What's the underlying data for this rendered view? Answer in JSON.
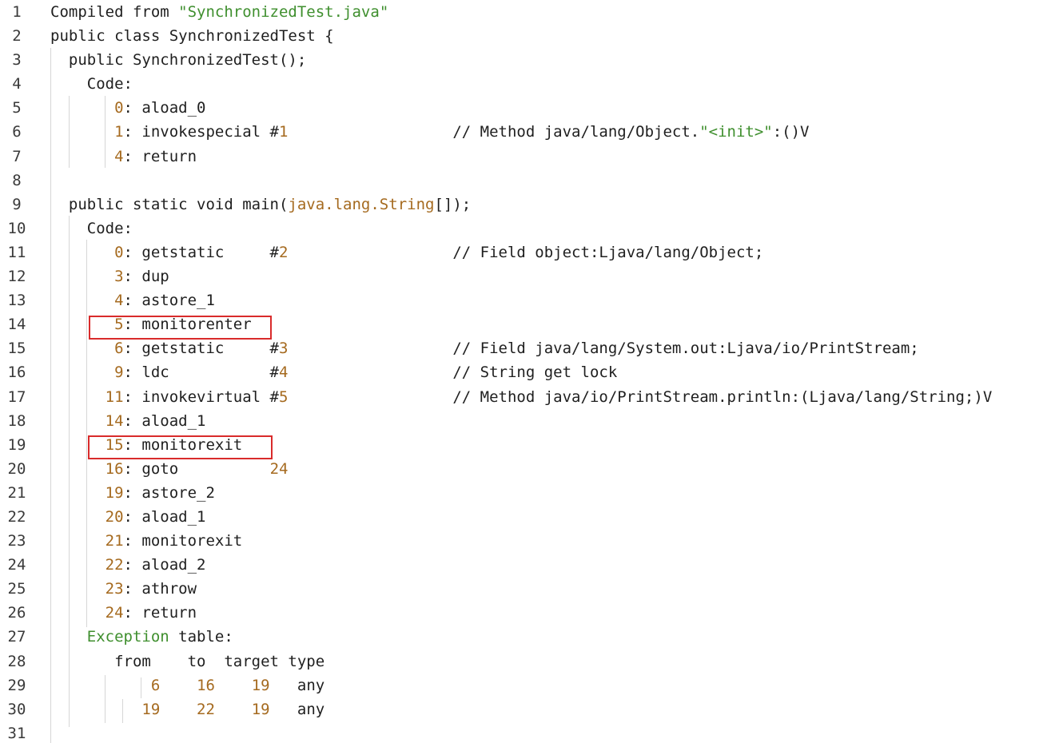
{
  "editor": {
    "lines": [
      {
        "n": "1",
        "segs": [
          [
            "Compiled from ",
            "t"
          ],
          [
            "\"SynchronizedTest.java\"",
            "s"
          ]
        ]
      },
      {
        "n": "2",
        "segs": [
          [
            "public class SynchronizedTest {",
            "t"
          ]
        ]
      },
      {
        "n": "3",
        "segs": [
          [
            "  public SynchronizedTest();",
            "t"
          ]
        ]
      },
      {
        "n": "4",
        "segs": [
          [
            "    Code:",
            "t"
          ]
        ]
      },
      {
        "n": "5",
        "segs": [
          [
            "       ",
            "t"
          ],
          [
            "0",
            "n"
          ],
          [
            ": aload_0",
            "t"
          ]
        ]
      },
      {
        "n": "6",
        "segs": [
          [
            "       ",
            "t"
          ],
          [
            "1",
            "n"
          ],
          [
            ": invokespecial #",
            "t"
          ],
          [
            "1",
            "n"
          ],
          [
            "                  // Method java/lang/Object.",
            "t"
          ],
          [
            "\"<init>\"",
            "s"
          ],
          [
            ":()V",
            "t"
          ]
        ]
      },
      {
        "n": "7",
        "segs": [
          [
            "       ",
            "t"
          ],
          [
            "4",
            "n"
          ],
          [
            ": return",
            "t"
          ]
        ]
      },
      {
        "n": "8",
        "segs": [
          [
            "",
            "t"
          ]
        ]
      },
      {
        "n": "9",
        "segs": [
          [
            "  public static void main(",
            "t"
          ],
          [
            "java.lang.String",
            "n"
          ],
          [
            "[]);",
            "t"
          ]
        ]
      },
      {
        "n": "10",
        "segs": [
          [
            "    Code:",
            "t"
          ]
        ]
      },
      {
        "n": "11",
        "segs": [
          [
            "       ",
            "t"
          ],
          [
            "0",
            "n"
          ],
          [
            ": getstatic     #",
            "t"
          ],
          [
            "2",
            "n"
          ],
          [
            "                  // Field object:Ljava/lang/Object;",
            "t"
          ]
        ]
      },
      {
        "n": "12",
        "segs": [
          [
            "       ",
            "t"
          ],
          [
            "3",
            "n"
          ],
          [
            ": dup",
            "t"
          ]
        ]
      },
      {
        "n": "13",
        "segs": [
          [
            "       ",
            "t"
          ],
          [
            "4",
            "n"
          ],
          [
            ": astore_1",
            "t"
          ]
        ]
      },
      {
        "n": "14",
        "segs": [
          [
            "       ",
            "t"
          ],
          [
            "5",
            "n"
          ],
          [
            ": monitorenter",
            "t"
          ]
        ]
      },
      {
        "n": "15",
        "segs": [
          [
            "       ",
            "t"
          ],
          [
            "6",
            "n"
          ],
          [
            ": getstatic     #",
            "t"
          ],
          [
            "3",
            "n"
          ],
          [
            "                  // Field java/lang/System.out:Ljava/io/PrintStream;",
            "t"
          ]
        ]
      },
      {
        "n": "16",
        "segs": [
          [
            "       ",
            "t"
          ],
          [
            "9",
            "n"
          ],
          [
            ": ldc           #",
            "t"
          ],
          [
            "4",
            "n"
          ],
          [
            "                  // String get lock",
            "t"
          ]
        ]
      },
      {
        "n": "17",
        "segs": [
          [
            "      ",
            "t"
          ],
          [
            "11",
            "n"
          ],
          [
            ": invokevirtual #",
            "t"
          ],
          [
            "5",
            "n"
          ],
          [
            "                  // Method java/io/PrintStream.println:(Ljava/lang/String;)V",
            "t"
          ]
        ]
      },
      {
        "n": "18",
        "segs": [
          [
            "      ",
            "t"
          ],
          [
            "14",
            "n"
          ],
          [
            ": aload_1",
            "t"
          ]
        ]
      },
      {
        "n": "19",
        "segs": [
          [
            "      ",
            "t"
          ],
          [
            "15",
            "n"
          ],
          [
            ": monitorexit",
            "t"
          ]
        ]
      },
      {
        "n": "20",
        "segs": [
          [
            "      ",
            "t"
          ],
          [
            "16",
            "n"
          ],
          [
            ": goto          ",
            "t"
          ],
          [
            "24",
            "n"
          ]
        ]
      },
      {
        "n": "21",
        "segs": [
          [
            "      ",
            "t"
          ],
          [
            "19",
            "n"
          ],
          [
            ": astore_2",
            "t"
          ]
        ]
      },
      {
        "n": "22",
        "segs": [
          [
            "      ",
            "t"
          ],
          [
            "20",
            "n"
          ],
          [
            ": aload_1",
            "t"
          ]
        ]
      },
      {
        "n": "23",
        "segs": [
          [
            "      ",
            "t"
          ],
          [
            "21",
            "n"
          ],
          [
            ": monitorexit",
            "t"
          ]
        ]
      },
      {
        "n": "24",
        "segs": [
          [
            "      ",
            "t"
          ],
          [
            "22",
            "n"
          ],
          [
            ": aload_2",
            "t"
          ]
        ]
      },
      {
        "n": "25",
        "segs": [
          [
            "      ",
            "t"
          ],
          [
            "23",
            "n"
          ],
          [
            ": athrow",
            "t"
          ]
        ]
      },
      {
        "n": "26",
        "segs": [
          [
            "      ",
            "t"
          ],
          [
            "24",
            "n"
          ],
          [
            ": return",
            "t"
          ]
        ]
      },
      {
        "n": "27",
        "segs": [
          [
            "    ",
            "t"
          ],
          [
            "Exception",
            "s"
          ],
          [
            " table:",
            "t"
          ]
        ]
      },
      {
        "n": "28",
        "segs": [
          [
            "       from    to  target type",
            "t"
          ]
        ]
      },
      {
        "n": "29",
        "segs": [
          [
            "           ",
            "t"
          ],
          [
            "6",
            "n"
          ],
          [
            "    ",
            "t"
          ],
          [
            "16",
            "n"
          ],
          [
            "    ",
            "t"
          ],
          [
            "19",
            "n"
          ],
          [
            "   any",
            "t"
          ]
        ]
      },
      {
        "n": "30",
        "segs": [
          [
            "          ",
            "t"
          ],
          [
            "19",
            "n"
          ],
          [
            "    ",
            "t"
          ],
          [
            "22",
            "n"
          ],
          [
            "    ",
            "t"
          ],
          [
            "19",
            "n"
          ],
          [
            "   any",
            "t"
          ]
        ]
      },
      {
        "n": "31",
        "segs": [
          [
            "",
            "t"
          ]
        ]
      }
    ],
    "highlighted_lines": [
      "14",
      "19"
    ],
    "colors": {
      "string": "#3f8f2e",
      "number": "#a56a1f",
      "text": "#1f1f1f",
      "highlight_box": "#d92b2b",
      "indent_guide": "#d6d6d6"
    }
  }
}
